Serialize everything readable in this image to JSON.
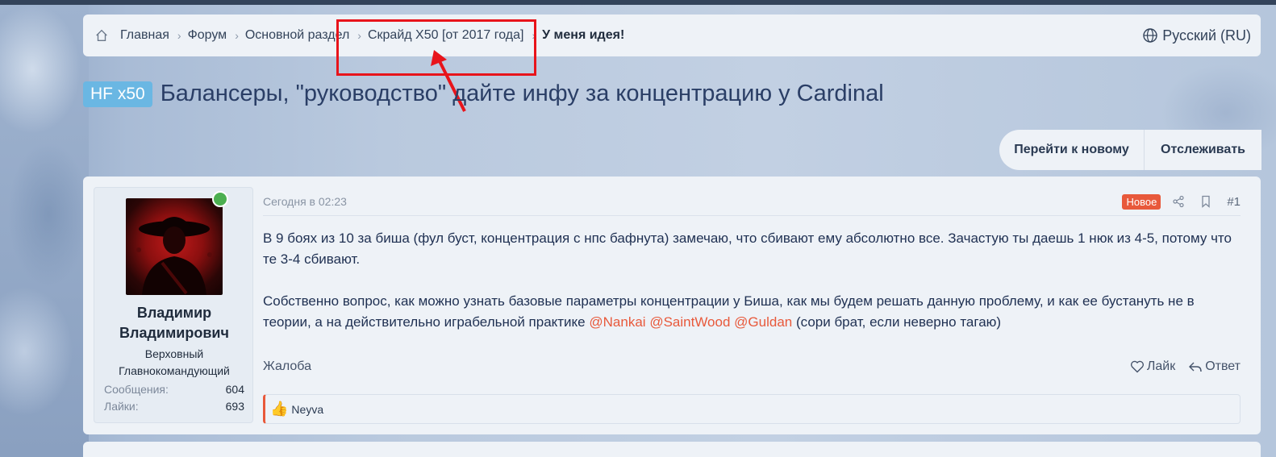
{
  "breadcrumb": {
    "items": [
      {
        "label": "Главная"
      },
      {
        "label": "Форум"
      },
      {
        "label": "Основной раздел"
      },
      {
        "label": "Скрайд X50 [от 2017 года]"
      },
      {
        "label": "У меня идея!"
      }
    ],
    "language": "Русский (RU)"
  },
  "thread": {
    "prefix": "HF x50",
    "title": "Балансеры, \"руководство\" дайте инфу за концентрацию у Cardinal"
  },
  "thread_actions": {
    "go_new": "Перейти к новому",
    "watch": "Отслеживать"
  },
  "post": {
    "user": {
      "name_line1": "Владимир",
      "name_line2": "Владимирович",
      "title_line1": "Верховный",
      "title_line2": "Главнокомандующий",
      "stats": [
        {
          "label": "Сообщения:",
          "value": "604"
        },
        {
          "label": "Лайки:",
          "value": "693"
        }
      ]
    },
    "time": "Сегодня в 02:23",
    "badge": "Новое",
    "number": "#1",
    "paragraph1": "В 9 боях из 10 за биша (фул буст, концентрация с нпс бафнута) замечаю, что сбивают ему абсолютно все. Зачастую ты даешь 1 нюк из 4-5, потому что те 3-4 сбивают.",
    "paragraph2_text": "Собственно вопрос, как можно узнать базовые параметры концентрации у Биша, как мы будем решать данную проблему, и как ее бустануть не в теории, а на действительно играбельной практике",
    "mentions": [
      "@Nankai",
      "@SaintWood",
      "@Guldan"
    ],
    "paragraph2_tail": "(сори брат, если неверно тагаю)",
    "report": "Жалоба",
    "like": "Лайк",
    "reply": "Ответ",
    "reaction_user": "Neyva"
  },
  "colors": {
    "accent": "#e8593b",
    "prefix_bg": "#6ab7e3",
    "annotation": "#e8141b",
    "title": "#2a3e66"
  }
}
